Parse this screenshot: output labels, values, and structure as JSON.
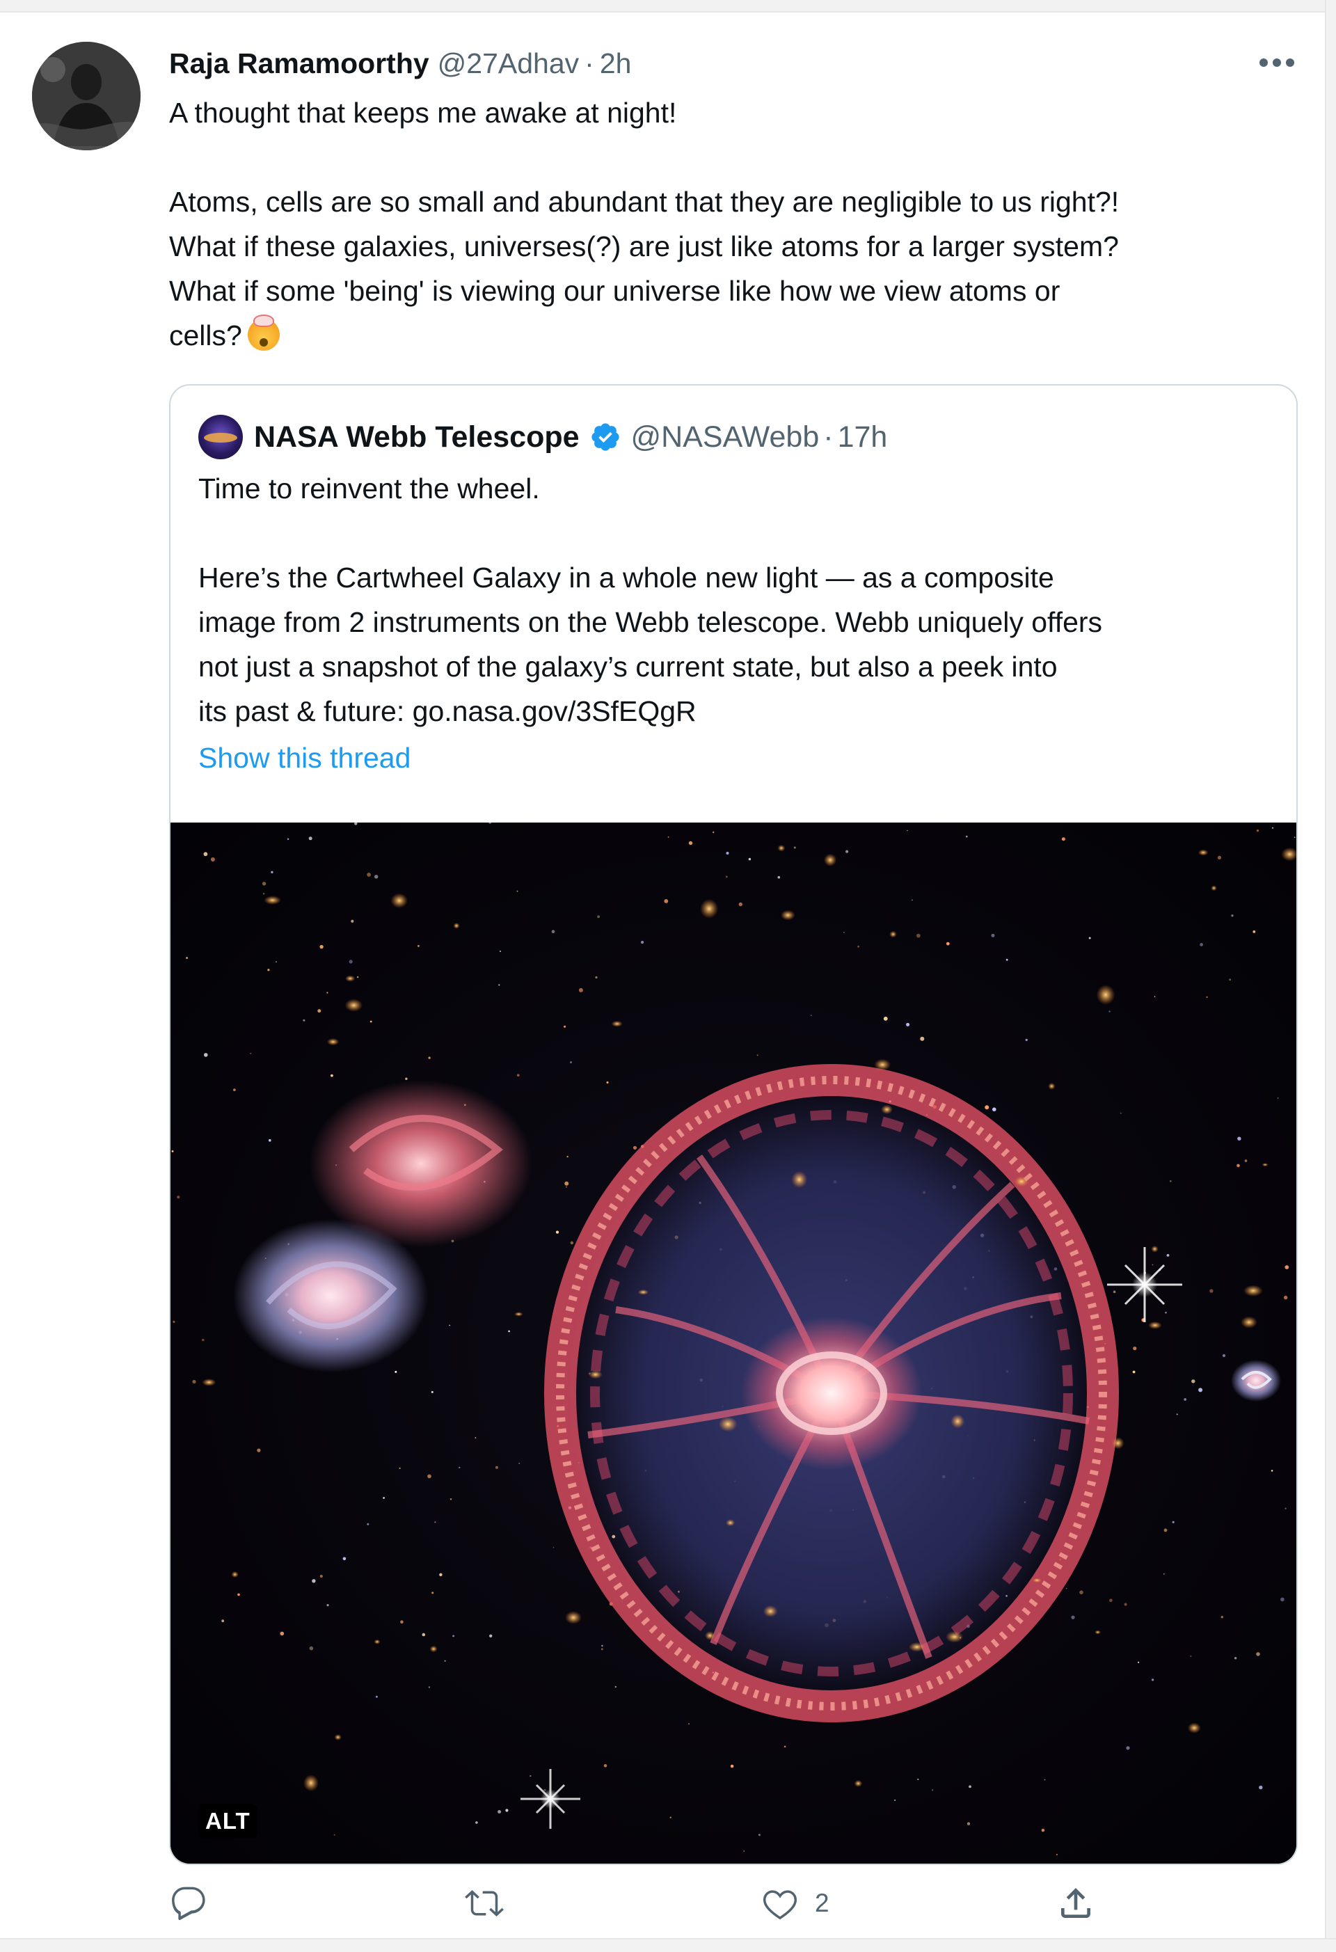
{
  "tweet": {
    "author_name": "Raja Ramamoorthy",
    "author_handle": "@27Adhav",
    "separator": "·",
    "time": "2h",
    "lines": [
      "A thought that keeps me awake at night!",
      "",
      "Atoms, cells are so small and abundant that they are negligible to us right?!",
      "What if these galaxies, universes(?) are just like atoms for a larger system?",
      "What if some 'being' is viewing our universe like how we view atoms or",
      "cells?"
    ],
    "emoji_icon": "exploding-head-emoji"
  },
  "quote": {
    "author_name": "NASA Webb Telescope",
    "verified": true,
    "author_handle": "@NASAWebb",
    "separator": "·",
    "time": "17h",
    "lines": [
      "Time to reinvent the wheel.",
      "",
      "Here’s the Cartwheel Galaxy in a whole new light — as a composite",
      "image from 2 instruments on the Webb telescope. Webb uniquely offers",
      "not just a snapshot of the galaxy’s current state, but also a peek into",
      "its past & future: go.nasa.gov/3SfEQgR"
    ],
    "show_thread_label": "Show this thread",
    "media_alt_badge": "ALT"
  },
  "actions": {
    "reply_count": "",
    "retweet_count": "",
    "like_count": "2",
    "share_count": ""
  },
  "colors": {
    "accent": "#1d9bf0",
    "secondary_text": "#536471",
    "primary_text": "#0f1419",
    "border": "#cfd9de"
  }
}
